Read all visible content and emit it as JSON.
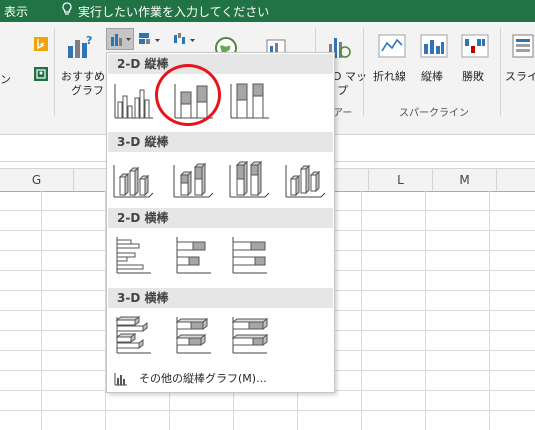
{
  "titlebar": {
    "tab_display": "表示",
    "tell_me": "実行したい作業を入力してください",
    "tell_me_icon": "lightbulb-icon"
  },
  "ribbon": {
    "left_partial_label": "ン",
    "recommended": {
      "line1": "おすすめ",
      "line2": "グラフ"
    },
    "map": {
      "line1": "D マッ",
      "line2": "プ"
    },
    "tour_group_partial": "アー",
    "sparklines": {
      "group_label": "スパークライン",
      "line": "折れ線",
      "column": "縦棒",
      "winloss": "勝敗"
    },
    "slicer_partial": "スライ"
  },
  "columns": {
    "g": "G",
    "l": "L",
    "m": "M"
  },
  "dropdown": {
    "section_2d_column": "2-D 縦棒",
    "section_3d_column": "3-D 縦棒",
    "section_2d_bar": "2-D 横棒",
    "section_3d_bar": "3-D 横棒",
    "more_charts": "その他の縦棒グラフ(M)..."
  },
  "colors": {
    "title_green": "#217346",
    "highlight_red": "#e8141b",
    "icon_blue": "#2e75b6"
  }
}
